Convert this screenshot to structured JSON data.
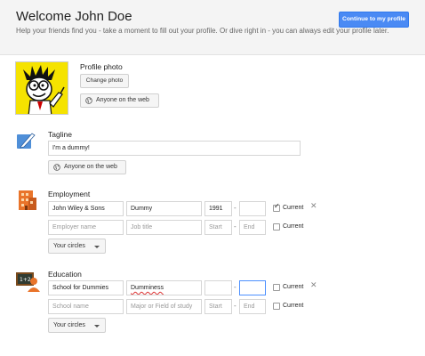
{
  "header": {
    "title": "Welcome John Doe",
    "subtitle": "Help your friends find you - take a moment to fill out your profile. Or dive right in - you can always edit your profile later.",
    "continue_label": "Continue to my profile"
  },
  "profile_photo": {
    "label": "Profile photo",
    "change_label": "Change photo",
    "visibility": "Anyone on the web",
    "avatar_icon": "dummies-character-avatar"
  },
  "tagline": {
    "label": "Tagline",
    "value": "I'm a dummy!",
    "visibility": "Anyone on the web",
    "icon": "pen-icon"
  },
  "employment": {
    "label": "Employment",
    "icon": "office-building-icon",
    "rows": [
      {
        "employer": "John Wiley & Sons",
        "title": "Dummy",
        "start": "1991",
        "end": "",
        "current_label": "Current",
        "current": true
      },
      {
        "employer_placeholder": "Employer name",
        "title_placeholder": "Job title",
        "start_placeholder": "Start",
        "end_placeholder": "End",
        "current_label": "Current",
        "current": false
      }
    ],
    "circles_label": "Your circles"
  },
  "education": {
    "label": "Education",
    "icon": "school-blackboard-icon",
    "rows": [
      {
        "school": "School for Dummies",
        "field": "Dumminess",
        "start": "",
        "end": "",
        "current_label": "Current",
        "current": false
      },
      {
        "school_placeholder": "School name",
        "field_placeholder": "Major or Field of study",
        "start_placeholder": "Start",
        "end_placeholder": "End",
        "current_label": "Current",
        "current": false
      }
    ],
    "circles_label": "Your circles"
  },
  "colors": {
    "primary_button": "#4a8af4",
    "focus_border": "#4d90fe",
    "header_bg": "#f4f4f4"
  }
}
